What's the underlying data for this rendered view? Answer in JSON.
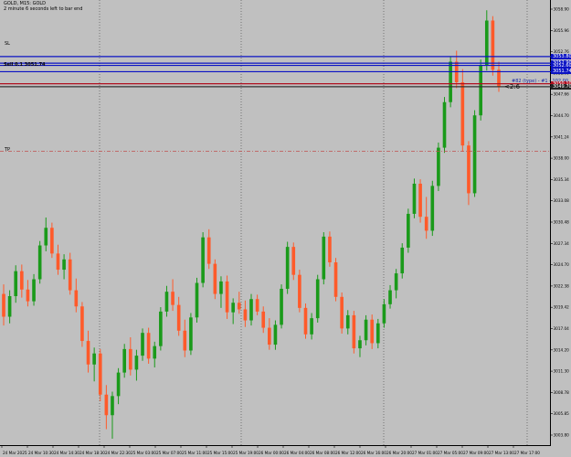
{
  "header": {
    "symbol_title": "GOLD, M15: GOLD",
    "countdown_note": "2 minute 6 seconds left to bar end"
  },
  "levels": {
    "sl_label": "SL",
    "tp_label": "TP",
    "order_label": "Sell 0.1  3051.74",
    "pending_label": "#82 (type) - #1 - 102.00",
    "timer": "<2:6",
    "lines": [
      {
        "name": "blue-level-1",
        "price": 3053.8,
        "color": "#0b13c4",
        "style": "solid",
        "tag": "3053.80",
        "tag_style": "b"
      },
      {
        "name": "blue-level-2",
        "price": 3052.9,
        "color": "#0b13c4",
        "style": "solid",
        "tag": "3052.90",
        "tag_style": "b"
      },
      {
        "name": "blue-level-3",
        "price": 3052.6,
        "color": "#0b13c4",
        "style": "solid",
        "tag": "3052.60",
        "tag_style": "b"
      },
      {
        "name": "blue-level-4",
        "price": 3051.74,
        "color": "#0b13c4",
        "style": "solid",
        "tag": "3051.74",
        "tag_style": "b"
      },
      {
        "name": "red-level-1",
        "price": 3050.1,
        "color": "#b01020",
        "style": "solid",
        "tag": "3050.10",
        "tag_style": "r"
      },
      {
        "name": "current-price-level",
        "price": 3049.7,
        "color": "#333333",
        "style": "solid",
        "tag": "3049.70",
        "tag_style": "d"
      },
      {
        "name": "tp-level",
        "price": 3040.9,
        "color": "#c0504d",
        "style": "dashdot",
        "tag": "",
        "tag_style": ""
      }
    ]
  },
  "time_axis": {
    "labels": [
      "24 Mar 2025",
      "24 Mar 10:30",
      "24 Mar 14:30",
      "24 Mar 18:30",
      "24 Mar 22:30",
      "25 Mar 03:00",
      "25 Mar 07:00",
      "25 Mar 11:00",
      "25 Mar 15:00",
      "25 Mar 19:00",
      "26 Mar 00:00",
      "26 Mar 04:00",
      "26 Mar 08:00",
      "26 Mar 12:00",
      "26 Mar 16:00",
      "26 Mar 20:00",
      "27 Mar 01:00",
      "27 Mar 05:00",
      "27 Mar 09:00",
      "27 Mar 13:00",
      "27 Mar 17:00"
    ]
  },
  "price_axis": {
    "labels": [
      "3058.90",
      "3055.96",
      "3052.76",
      "3051.00",
      "3047.66",
      "3044.70",
      "3041.24",
      "3038.00",
      "3035.34",
      "3033.08",
      "3030.48",
      "3027.34",
      "3024.70",
      "3022.38",
      "3019.42",
      "3017.04",
      "3014.20",
      "3011.30",
      "3008.78",
      "3005.85",
      "3003.80"
    ]
  },
  "chart_data": {
    "type": "candlestick",
    "symbol": "GOLD",
    "timeframe": "M15",
    "ylim": [
      3001.3,
      3061.0
    ],
    "grid": "vertical dotted",
    "up_color": "#1a9a1a",
    "down_color": "#ff5a2a",
    "ohlc": [
      [
        3021.5,
        3022.8,
        3017.2,
        3018.4
      ],
      [
        3018.4,
        3022.0,
        3017.5,
        3021.2
      ],
      [
        3021.2,
        3025.4,
        3020.3,
        3024.6
      ],
      [
        3024.6,
        3025.5,
        3021.0,
        3022.1
      ],
      [
        3022.1,
        3023.4,
        3019.8,
        3020.5
      ],
      [
        3020.5,
        3024.2,
        3019.9,
        3023.5
      ],
      [
        3023.5,
        3028.7,
        3022.9,
        3028.1
      ],
      [
        3028.1,
        3031.9,
        3027.3,
        3030.5
      ],
      [
        3030.5,
        3031.2,
        3026.4,
        3027.0
      ],
      [
        3027.0,
        3028.2,
        3024.1,
        3024.8
      ],
      [
        3024.8,
        3026.9,
        3023.5,
        3026.2
      ],
      [
        3026.2,
        3027.1,
        3021.4,
        3022.0
      ],
      [
        3022.0,
        3023.6,
        3019.0,
        3019.8
      ],
      [
        3019.8,
        3020.4,
        3014.3,
        3015.1
      ],
      [
        3015.1,
        3016.5,
        3010.8,
        3011.9
      ],
      [
        3011.9,
        3014.2,
        3009.6,
        3013.4
      ],
      [
        3013.4,
        3014.0,
        3006.9,
        3007.8
      ],
      [
        3007.8,
        3009.1,
        3003.1,
        3005.0
      ],
      [
        3005.0,
        3008.2,
        3001.8,
        3007.6
      ],
      [
        3007.6,
        3011.4,
        3006.5,
        3010.8
      ],
      [
        3010.8,
        3014.7,
        3010.1,
        3014.0
      ],
      [
        3014.0,
        3015.6,
        3010.4,
        3011.2
      ],
      [
        3011.2,
        3013.9,
        3009.7,
        3013.1
      ],
      [
        3013.1,
        3016.8,
        3012.4,
        3016.2
      ],
      [
        3016.2,
        3016.9,
        3012.0,
        3012.7
      ],
      [
        3012.7,
        3015.0,
        3011.5,
        3014.4
      ],
      [
        3014.4,
        3019.7,
        3013.8,
        3019.1
      ],
      [
        3019.1,
        3022.6,
        3018.4,
        3021.8
      ],
      [
        3021.8,
        3023.5,
        3019.2,
        3020.0
      ],
      [
        3020.0,
        3021.1,
        3015.8,
        3016.5
      ],
      [
        3016.5,
        3018.0,
        3012.9,
        3013.8
      ],
      [
        3013.8,
        3018.9,
        3013.2,
        3018.3
      ],
      [
        3018.3,
        3023.7,
        3017.6,
        3023.0
      ],
      [
        3023.0,
        3029.9,
        3022.4,
        3029.2
      ],
      [
        3029.2,
        3030.3,
        3024.9,
        3025.6
      ],
      [
        3025.6,
        3026.2,
        3020.8,
        3021.5
      ],
      [
        3021.5,
        3023.9,
        3019.6,
        3023.2
      ],
      [
        3023.2,
        3024.0,
        3018.1,
        3019.0
      ],
      [
        3019.0,
        3020.9,
        3017.4,
        3020.3
      ],
      [
        3020.3,
        3021.8,
        3018.8,
        3019.4
      ],
      [
        3019.4,
        3020.6,
        3017.0,
        3017.9
      ],
      [
        3017.9,
        3021.5,
        3017.2,
        3020.8
      ],
      [
        3020.8,
        3021.4,
        3018.6,
        3019.1
      ],
      [
        3019.1,
        3019.8,
        3016.2,
        3016.9
      ],
      [
        3016.9,
        3018.2,
        3013.9,
        3014.6
      ],
      [
        3014.6,
        3017.9,
        3013.9,
        3017.3
      ],
      [
        3017.3,
        3022.8,
        3016.8,
        3022.2
      ],
      [
        3022.2,
        3028.6,
        3021.5,
        3027.9
      ],
      [
        3027.9,
        3028.5,
        3023.4,
        3024.1
      ],
      [
        3024.1,
        3024.8,
        3019.0,
        3019.6
      ],
      [
        3019.6,
        3020.2,
        3015.4,
        3016.0
      ],
      [
        3016.0,
        3018.9,
        3015.3,
        3018.2
      ],
      [
        3018.2,
        3024.1,
        3017.6,
        3023.5
      ],
      [
        3023.5,
        3029.9,
        3022.8,
        3029.3
      ],
      [
        3029.3,
        3030.0,
        3025.2,
        3025.8
      ],
      [
        3025.8,
        3026.4,
        3020.5,
        3021.1
      ],
      [
        3021.1,
        3021.7,
        3016.1,
        3016.8
      ],
      [
        3016.8,
        3019.3,
        3016.0,
        3018.6
      ],
      [
        3018.6,
        3019.2,
        3013.4,
        3014.1
      ],
      [
        3014.1,
        3015.8,
        3012.9,
        3015.2
      ],
      [
        3015.2,
        3018.6,
        3014.5,
        3018.0
      ],
      [
        3018.0,
        3018.7,
        3014.0,
        3014.8
      ],
      [
        3014.8,
        3018.1,
        3014.1,
        3017.5
      ],
      [
        3017.5,
        3020.8,
        3016.9,
        3020.1
      ],
      [
        3020.1,
        3022.7,
        3019.5,
        3022.0
      ],
      [
        3022.0,
        3024.9,
        3020.9,
        3024.3
      ],
      [
        3024.3,
        3028.4,
        3023.6,
        3027.8
      ],
      [
        3027.8,
        3033.1,
        3027.1,
        3032.4
      ],
      [
        3032.4,
        3037.2,
        3031.8,
        3036.5
      ],
      [
        3036.5,
        3037.1,
        3031.2,
        3032.0
      ],
      [
        3032.0,
        3034.7,
        3029.0,
        3030.1
      ],
      [
        3030.1,
        3036.9,
        3029.4,
        3036.2
      ],
      [
        3036.2,
        3042.1,
        3035.5,
        3041.4
      ],
      [
        3041.4,
        3048.3,
        3040.7,
        3047.6
      ],
      [
        3047.6,
        3053.8,
        3046.9,
        3053.1
      ],
      [
        3053.1,
        3054.6,
        3049.5,
        3050.3
      ],
      [
        3050.3,
        3052.1,
        3040.9,
        3041.7
      ],
      [
        3041.7,
        3042.3,
        3033.6,
        3035.2
      ],
      [
        3035.2,
        3046.5,
        3034.7,
        3045.8
      ],
      [
        3045.8,
        3053.4,
        3045.1,
        3052.6
      ],
      [
        3052.6,
        3060.1,
        3051.9,
        3058.7
      ],
      [
        3058.7,
        3059.3,
        3051.2,
        3052.0
      ],
      [
        3052.0,
        3053.1,
        3049.0,
        3049.7
      ]
    ]
  }
}
